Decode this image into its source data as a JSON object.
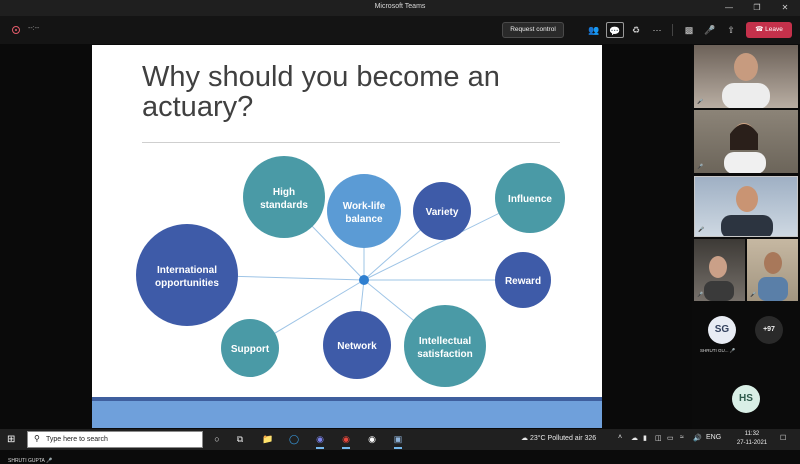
{
  "window": {
    "title": "Microsoft Teams",
    "controls": [
      "—",
      "❐",
      "✕"
    ]
  },
  "toolbar": {
    "timer": "--:--",
    "request_control_label": "Request control",
    "leave_label": "Leave",
    "icons": [
      "people-icon",
      "chat-icon",
      "breakout-icon",
      "more-icon",
      "camera-icon",
      "mic-icon",
      "share-icon"
    ]
  },
  "slide": {
    "title_line1": "Why should you become an",
    "title_line2": "actuary?",
    "nodes": [
      {
        "label1": "High",
        "label2": "standards",
        "color": "#4a9aa6"
      },
      {
        "label1": "Work-life",
        "label2": "balance",
        "color": "#5b9bd5"
      },
      {
        "label1": "Variety",
        "label2": "",
        "color": "#3e5ba8"
      },
      {
        "label1": "Influence",
        "label2": "",
        "color": "#4a9aa6"
      },
      {
        "label1": "International",
        "label2": "opportunities",
        "color": "#3e5ba8"
      },
      {
        "label1": "Reward",
        "label2": "",
        "color": "#3e5ba8"
      },
      {
        "label1": "Support",
        "label2": "",
        "color": "#4a9aa6"
      },
      {
        "label1": "Network",
        "label2": "",
        "color": "#3e5ba8"
      },
      {
        "label1": "Intellectual",
        "label2": "satisfaction",
        "color": "#4a9aa6"
      }
    ],
    "hub_color": "#2f7fd0",
    "line_color": "#9ec4e6"
  },
  "presenter": {
    "name": "SHRUTI GUPTA"
  },
  "gallery": {
    "participant_initials_1": "SG",
    "participant_name_1": "SHRUTI GU...",
    "more_count": "+97",
    "participant_initials_2": "HS"
  },
  "taskbar": {
    "search_placeholder": "Type here to search",
    "weather": "23°C  Polluted air 326",
    "language": "ENG",
    "time": "11:32",
    "date": "27-11-2021"
  },
  "colors": {
    "leave_red": "#c4314b",
    "avatar_sg_bg": "#e8ecf4",
    "avatar_sg_fg": "#33415e",
    "avatar_hs_bg": "#d9efe6",
    "avatar_hs_fg": "#2e5a4b"
  }
}
